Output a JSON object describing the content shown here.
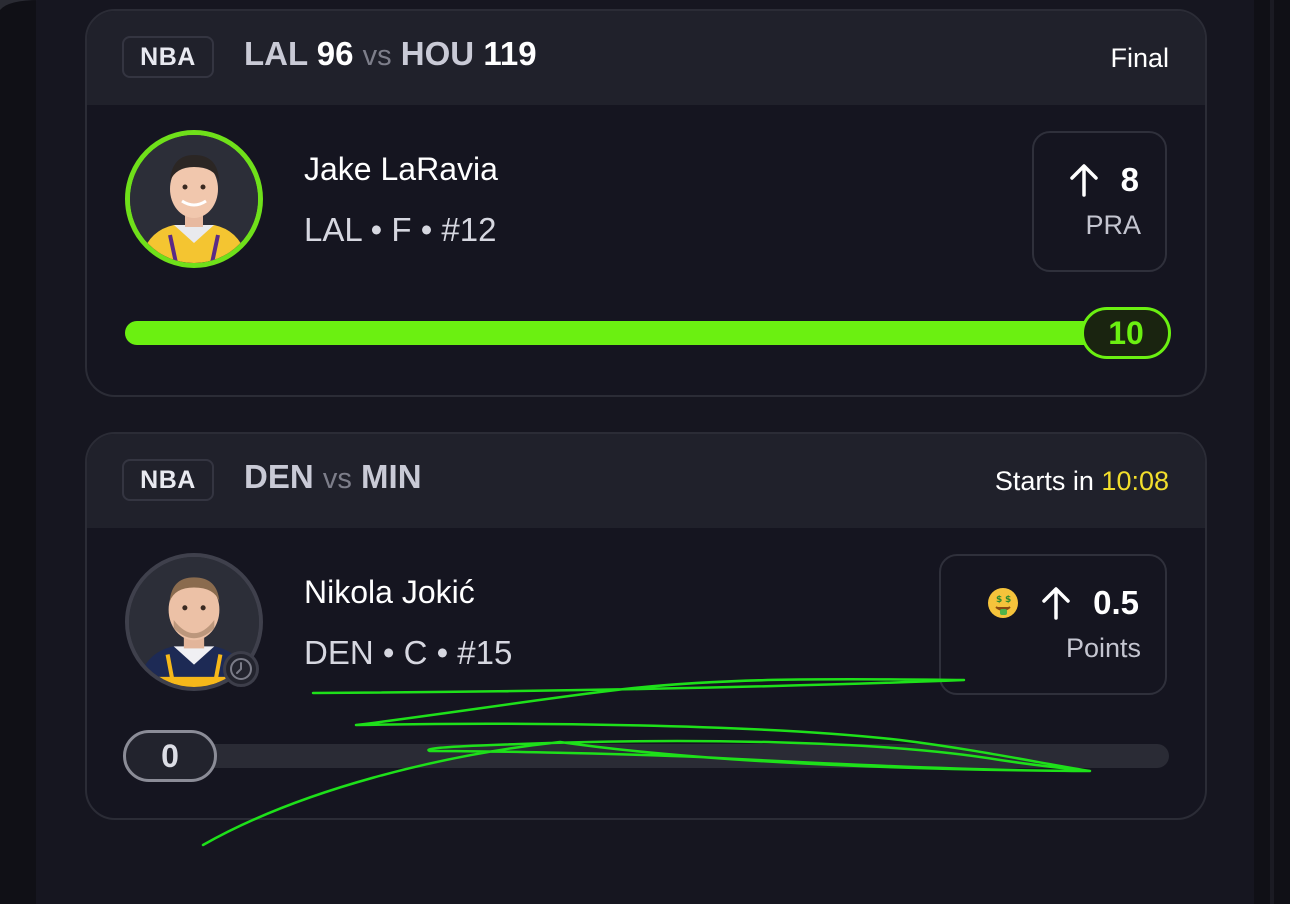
{
  "games": [
    {
      "league": "NBA",
      "away_team": "LAL",
      "away_score": "96",
      "vs": "vs",
      "home_team": "HOU",
      "home_score": "119",
      "status": "Final",
      "player": {
        "name": "Jake LaRavia",
        "meta": "LAL • F • #12",
        "avatar": "player-headshot-lakers"
      },
      "pick": {
        "direction_icon": "arrow-up-icon",
        "line": "8",
        "stat": "PRA"
      },
      "progress": {
        "value": "10",
        "fraction": 1.0,
        "color": "#6bf011"
      }
    },
    {
      "league": "NBA",
      "away_team": "DEN",
      "vs": "vs",
      "home_team": "MIN",
      "status_prefix": "Starts in",
      "countdown": "10:08",
      "player": {
        "name": "Nikola Jokić",
        "meta": "DEN • C • #15",
        "avatar": "player-headshot-nuggets"
      },
      "pick": {
        "badge_icon": "money-mouth-face-icon",
        "direction_icon": "arrow-up-icon",
        "line": "0.5",
        "stat": "Points"
      },
      "progress": {
        "value": "0",
        "fraction": 0.0
      }
    }
  ],
  "colors": {
    "accent_green": "#6bf011",
    "countdown_yellow": "#f2de2c",
    "card_bg": "#151520",
    "header_bg": "#20212b"
  }
}
